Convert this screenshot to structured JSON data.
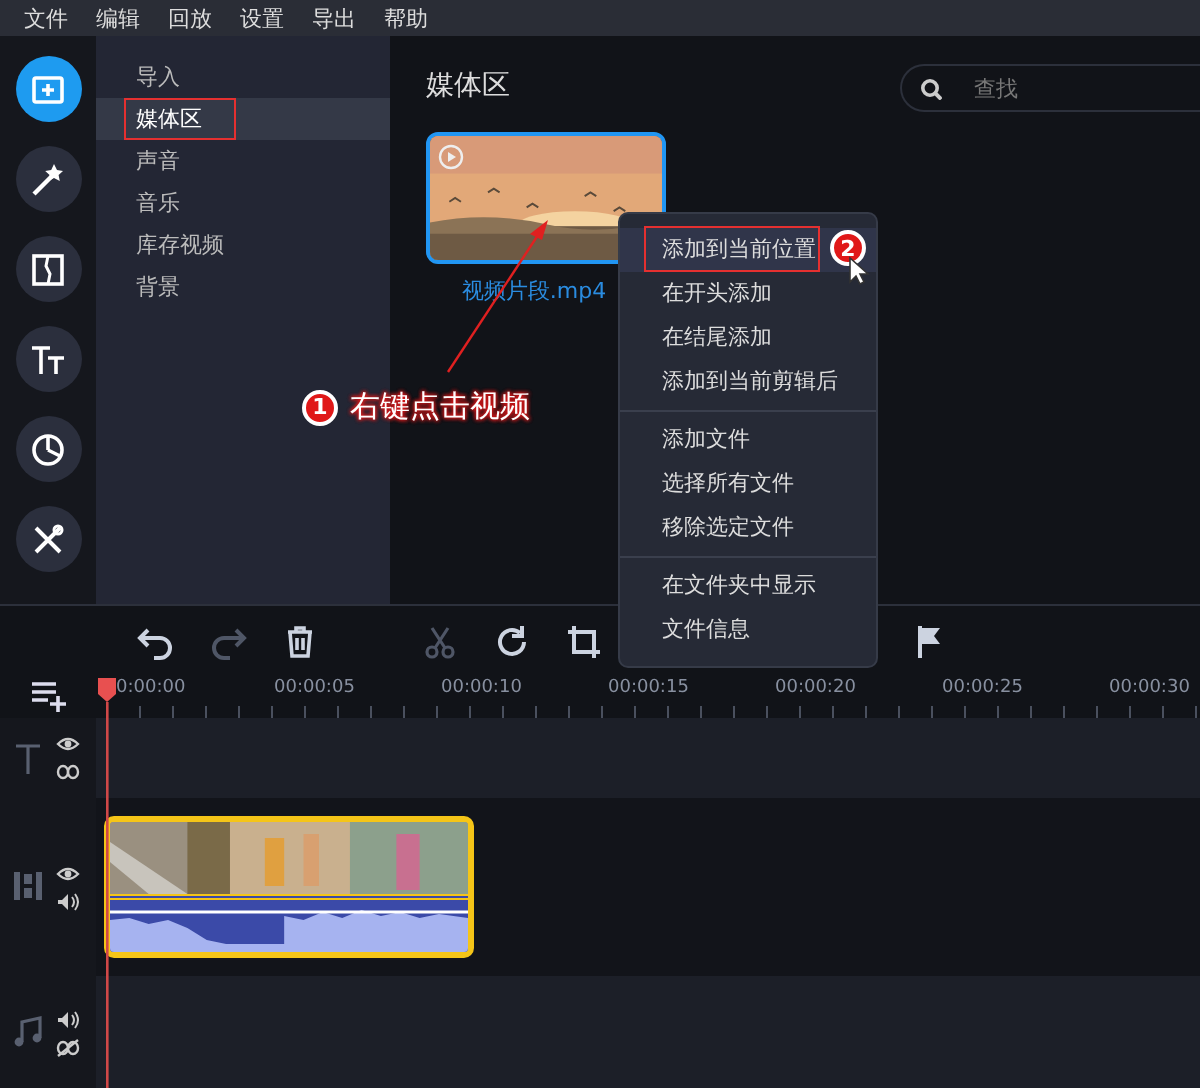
{
  "menu_bar": [
    "文件",
    "编辑",
    "回放",
    "设置",
    "导出",
    "帮助"
  ],
  "tool_rail": [
    {
      "selected": true
    },
    {
      "selected": false
    },
    {
      "selected": false
    },
    {
      "selected": false
    },
    {
      "selected": false
    },
    {
      "selected": false
    }
  ],
  "sidebar": {
    "items": [
      {
        "label": "导入",
        "selected": false
      },
      {
        "label": "媒体区",
        "selected": true
      },
      {
        "label": "声音",
        "selected": false
      },
      {
        "label": "音乐",
        "selected": false
      },
      {
        "label": "库存视频",
        "selected": false
      },
      {
        "label": "背景",
        "selected": false
      }
    ]
  },
  "media": {
    "title": "媒体区",
    "search": {
      "placeholder": "查找"
    },
    "files": [
      {
        "name": "视频片段.mp4",
        "selected": true
      }
    ]
  },
  "context_menu": {
    "groups": [
      [
        {
          "label": "添加到当前位置",
          "selected": true
        },
        {
          "label": "在开头添加",
          "selected": false
        },
        {
          "label": "在结尾添加",
          "selected": false
        },
        {
          "label": "添加到当前剪辑后",
          "selected": false
        }
      ],
      [
        {
          "label": "添加文件",
          "selected": false
        },
        {
          "label": "选择所有文件",
          "selected": false
        },
        {
          "label": "移除选定文件",
          "selected": false
        }
      ],
      [
        {
          "label": "在文件夹中显示",
          "selected": false
        },
        {
          "label": "文件信息",
          "selected": false
        }
      ]
    ]
  },
  "annotations": [
    {
      "kind": "callout",
      "number": "1",
      "text": "右键点击视频"
    },
    {
      "kind": "badge",
      "number": "2"
    }
  ],
  "timeline": {
    "toolbar": [
      {
        "kind": "undo",
        "disabled": false
      },
      {
        "kind": "redo",
        "disabled": true
      },
      {
        "kind": "delete",
        "disabled": false
      },
      {
        "kind": "cut",
        "disabled": true
      },
      {
        "kind": "rotate",
        "disabled": false
      },
      {
        "kind": "crop",
        "disabled": false
      },
      {
        "kind": "flag",
        "disabled": false
      }
    ],
    "ruler": [
      "0:00:00",
      "00:00:05",
      "00:00:10",
      "00:00:15",
      "00:00:20",
      "00:00:25",
      "00:00:30"
    ],
    "tracks": [
      {
        "kind": "text"
      },
      {
        "kind": "video"
      },
      {
        "kind": "audio"
      }
    ]
  }
}
